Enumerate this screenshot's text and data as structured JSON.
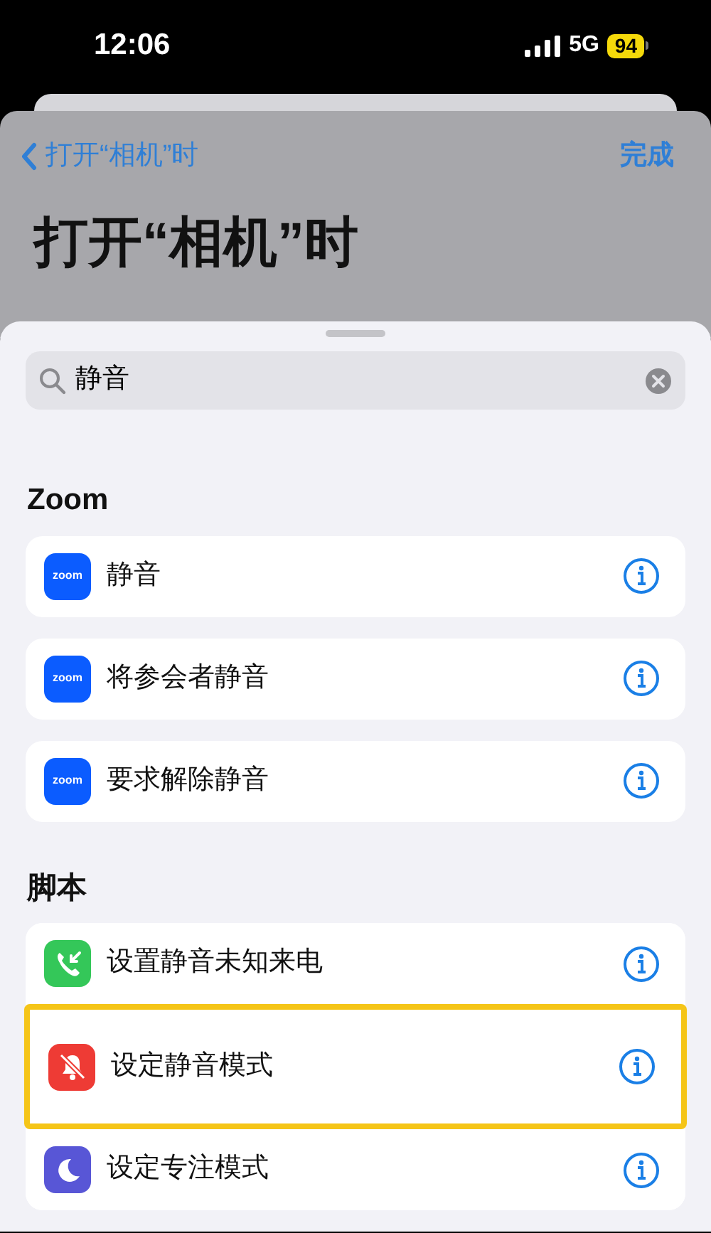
{
  "status_bar": {
    "time": "12:06",
    "network": "5G",
    "battery": "94"
  },
  "nav": {
    "back": "打开“相机”时",
    "done": "完成",
    "title": "打开“相机”时"
  },
  "search": {
    "value": "静音"
  },
  "sections": [
    {
      "header": "Zoom",
      "grouped": false,
      "items": [
        {
          "kind": "zoom",
          "icon_text": "zoom",
          "label": "静音",
          "highlighted": false
        },
        {
          "kind": "zoom",
          "icon_text": "zoom",
          "label": "将参会者静音",
          "highlighted": false
        },
        {
          "kind": "zoom",
          "icon_text": "zoom",
          "label": "要求解除静音",
          "highlighted": false
        }
      ]
    },
    {
      "header": "脚本",
      "grouped": true,
      "items": [
        {
          "kind": "phone",
          "label": "设置静音未知来电",
          "highlighted": false
        },
        {
          "kind": "bell",
          "label": "设定静音模式",
          "highlighted": true
        },
        {
          "kind": "moon",
          "label": "设定专注模式",
          "highlighted": false
        }
      ]
    }
  ]
}
